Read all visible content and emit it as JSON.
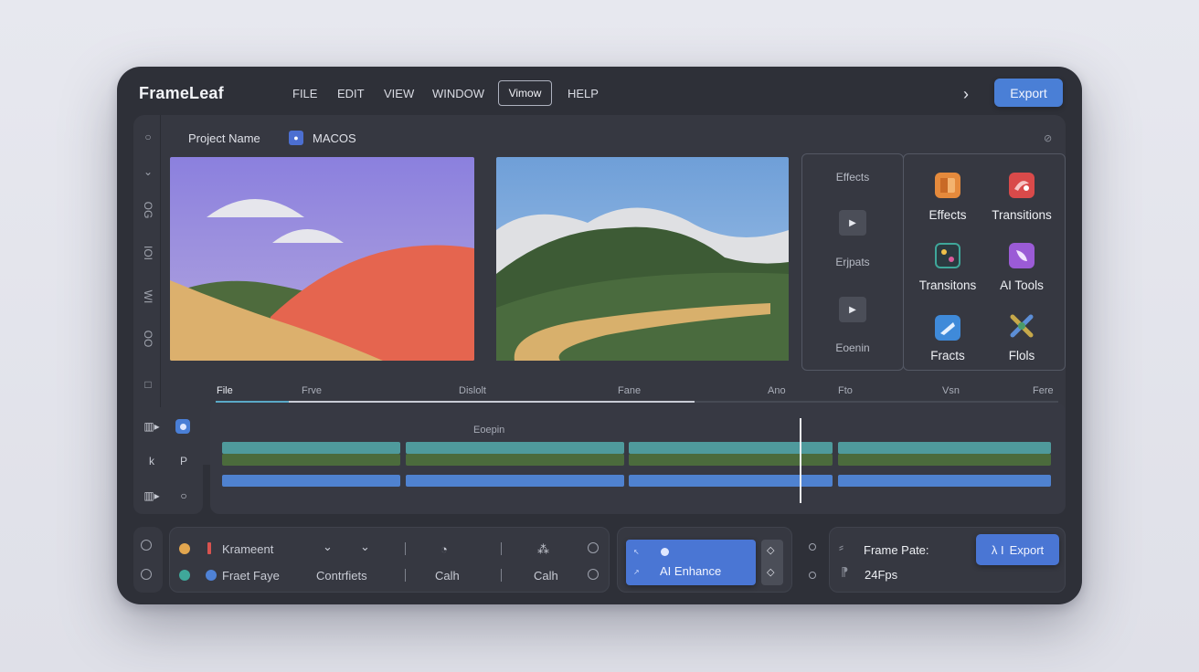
{
  "app": {
    "title": "FrameLeaf",
    "export_label": "Export"
  },
  "menu": {
    "items": [
      "FILE",
      "EDIT",
      "VIEW",
      "WINDOW",
      "Vimow",
      "HELP"
    ],
    "active": "Vimow"
  },
  "project": {
    "name_label": "Project Name",
    "platform_label": "MACOS"
  },
  "side_strip": [
    "○",
    "⌄",
    "OG",
    "IOI",
    "WI",
    "OO",
    "□"
  ],
  "effects_panel": {
    "labels": [
      "Effects",
      "Erjpats",
      "Eoenin"
    ]
  },
  "tools_grid": [
    {
      "label": "Effects",
      "icon": "effects-icon",
      "color": "#e58a3c"
    },
    {
      "label": "Transitions",
      "icon": "transitions-icon",
      "color": "#d94a4a"
    },
    {
      "label": "Transitons",
      "icon": "transitons-icon",
      "color": "#3fa79a"
    },
    {
      "label": "AI Tools",
      "icon": "ai-tools-icon",
      "color": "#9b5bd6"
    },
    {
      "label": "Fracts",
      "icon": "fracts-icon",
      "color": "#3f8ad9"
    },
    {
      "label": "Flols",
      "icon": "flols-icon",
      "color": "#c6a84a"
    }
  ],
  "timeline": {
    "ruler": [
      "File",
      "Frve",
      "Dislolt",
      "Fane",
      "Ano",
      "Fto",
      "Vsn",
      "Fere"
    ],
    "caption": "Eoepin",
    "colors": {
      "teal": "#4f9a9c",
      "green": "#4b6b3c",
      "blue": "#4f82d0"
    }
  },
  "tool_pane": [
    "▥▸",
    "▣",
    "k",
    "P",
    "▥▸",
    "○"
  ],
  "bottom": {
    "row1": {
      "label": "Krameent",
      "glyph_a": "⌄",
      "glyph_b": "⌄",
      "glyph_c": "◔",
      "glyph_d": "⁂"
    },
    "row2": {
      "label": "Fraet Faye",
      "col_b": "Contrfiets",
      "col_c": "Calh",
      "col_d": "Calh"
    },
    "ai_enhance_label": "AI Enhance",
    "frame_rate_label": "Frame Pate:",
    "frame_rate_value": "24Fps",
    "export_label": "Export",
    "export_prefix": "λ I"
  }
}
